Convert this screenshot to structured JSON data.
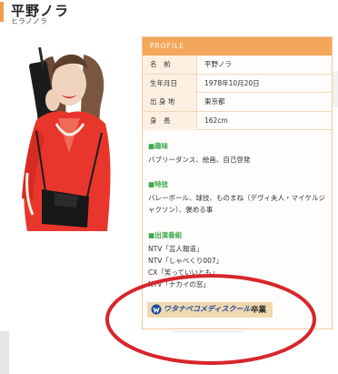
{
  "header": {
    "name": "平野ノラ",
    "name_kana": "ヒラノノラ"
  },
  "photo": {
    "alt": "平野ノラ"
  },
  "profile": {
    "header_label": "PROFILE",
    "rows": [
      {
        "key": "名　前",
        "value": "平野ノラ"
      },
      {
        "key": "生年月日",
        "value": "1978年10月20日"
      },
      {
        "key": "出 身 地",
        "value": "東京都"
      },
      {
        "key": "身　長",
        "value": "162cm"
      }
    ],
    "hobby": {
      "title": "■趣味",
      "lines": [
        "バブリーダンス、絵画、自己啓発"
      ]
    },
    "skill": {
      "title": "■特技",
      "lines": [
        "バレーボール、球技、ものまね（デヴィ夫人・マイケルジャクソン）、褒める事"
      ]
    },
    "appearances": {
      "title": "■出演番組",
      "lines": [
        "NTV「芸人報道」",
        "NTV「しゃべくり007」",
        "CX「笑っていいとも」",
        "NTV「ナカイの窓」"
      ]
    },
    "school": {
      "name": "ワタナベコメディスクール",
      "status": "卒業"
    }
  },
  "colors": {
    "accent": "#f4a65a",
    "section_title": "#3fa84f",
    "annotation": "#d7262c",
    "school_text": "#1f4aa0"
  }
}
